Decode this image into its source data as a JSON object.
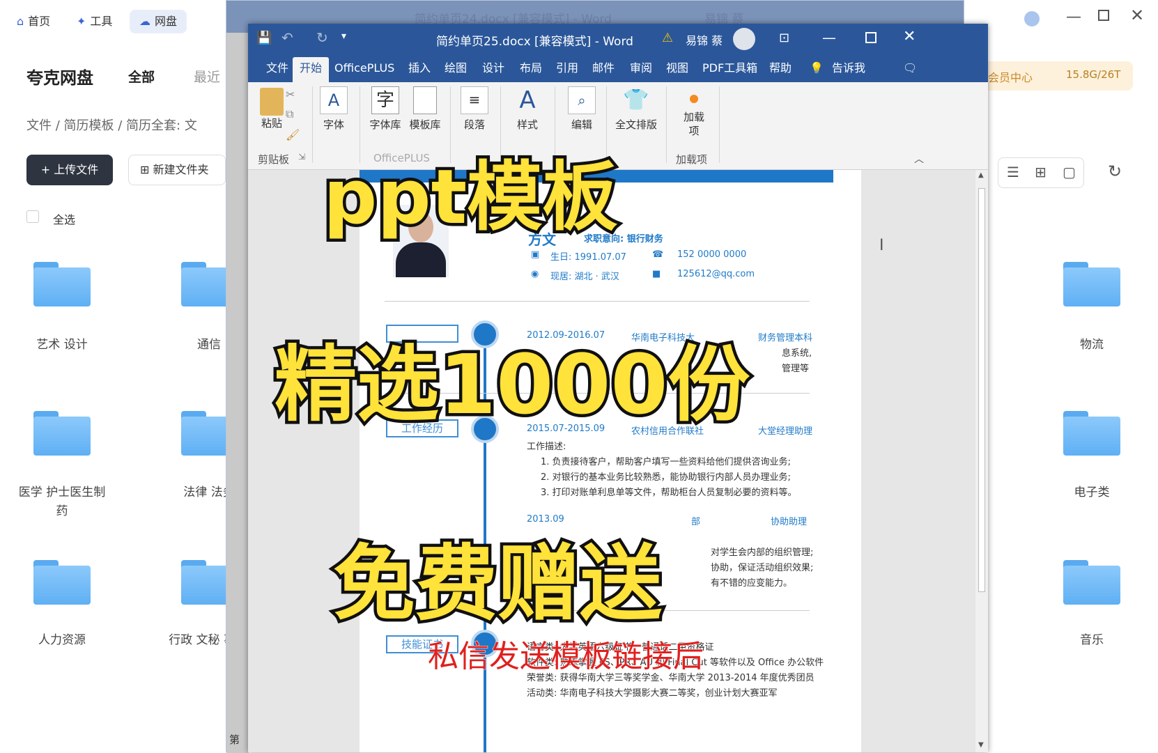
{
  "quark": {
    "tabs": [
      "首页",
      "工具",
      "网盘"
    ],
    "title": "夸克网盘",
    "filters": [
      "全部",
      "最近"
    ],
    "breadcrumb": [
      "文件",
      "简历模板",
      "简历全套: 文"
    ],
    "upload_label": "+ 上传文件",
    "newfolder_label": "新建文件夹",
    "selectall_label": "全选",
    "member_label": "会员中心",
    "storage_label": "15.8G/26T",
    "folders_left": [
      "艺术 设计",
      "医学 护士医生制药",
      "人力资源"
    ],
    "folders_mid": [
      "通信",
      "法律 法务",
      "行政 文秘 事"
    ],
    "folders_right": [
      "物流",
      "电子类",
      "音乐"
    ]
  },
  "word_back": {
    "title": "简约单页24.docx [兼容模式] - Word",
    "user": "易锦 蔡"
  },
  "word": {
    "title": "简约单页25.docx [兼容模式] - Word",
    "user": "易锦 蔡",
    "menus": [
      "文件",
      "开始",
      "OfficePLUS",
      "插入",
      "绘图",
      "设计",
      "布局",
      "引用",
      "邮件",
      "审阅",
      "视图",
      "PDF工具箱",
      "帮助",
      "告诉我"
    ],
    "ribbon": {
      "paste": "粘贴",
      "clipboard": "剪贴板",
      "font": "字体",
      "fontlib": "字体库",
      "templatelib": "模板库",
      "officeplus": "OfficePLUS",
      "paragraph": "段落",
      "styles": "样式",
      "editing": "编辑",
      "fulltext": "全文排版",
      "addins_btn": "加载项",
      "addins": "加载项"
    },
    "statusbar_left": "第"
  },
  "resume": {
    "name": "方文",
    "intent": "求职意向: 银行财务",
    "birth": "生日: 1991.07.07",
    "phone": "152 0000 0000",
    "location": "现居: 湖北 · 武汉",
    "email": "125612@qq.com",
    "edu_date": "2012.09-2016.07",
    "edu_school": "华南电子科技大",
    "edu_major": "财务管理本科",
    "edu_line1": "息系统,",
    "edu_line2": "管理等",
    "work_label": "工作经历",
    "work1_date": "2015.07-2015.09",
    "work1_org": "农村信用合作联社",
    "work1_role": "大堂经理助理",
    "work_desc_label": "工作描述:",
    "work1_items": [
      "1.  负责接待客户，帮助客户填写一些资料给他们提供咨询业务;",
      "2.  对银行的基本业务比较熟悉，能协助银行内部人员办理业务;",
      "3.  打印对账单利息单等文件，帮助柜台人员复制必要的资料等。"
    ],
    "work2_date": "2013.09",
    "work2_org": "部",
    "work2_role": "协助助理",
    "work2_items": [
      "对学生会内部的组织管理;",
      "协助，保证活动组织效果;",
      "有不错的应变能力。"
    ],
    "skills_label": "技能证书",
    "skills": [
      "语言类: 大学英语六级证书，普通话二甲资格证",
      "软件类: 熟练掌握 PS、PR、AU 和 Final Cut 等软件以及 Office 办公软件",
      "荣誉类: 获得华南大学三等奖学金、华南大学 2013-2014 年度优秀团员",
      "活动类: 华南电子科技大学摄影大赛二等奖，创业计划大赛亚军"
    ]
  },
  "overlay": {
    "line1": "ppt模板",
    "line2": "精选1000份",
    "line3": "免费赠送",
    "sub": "私信发送模板链接后"
  }
}
